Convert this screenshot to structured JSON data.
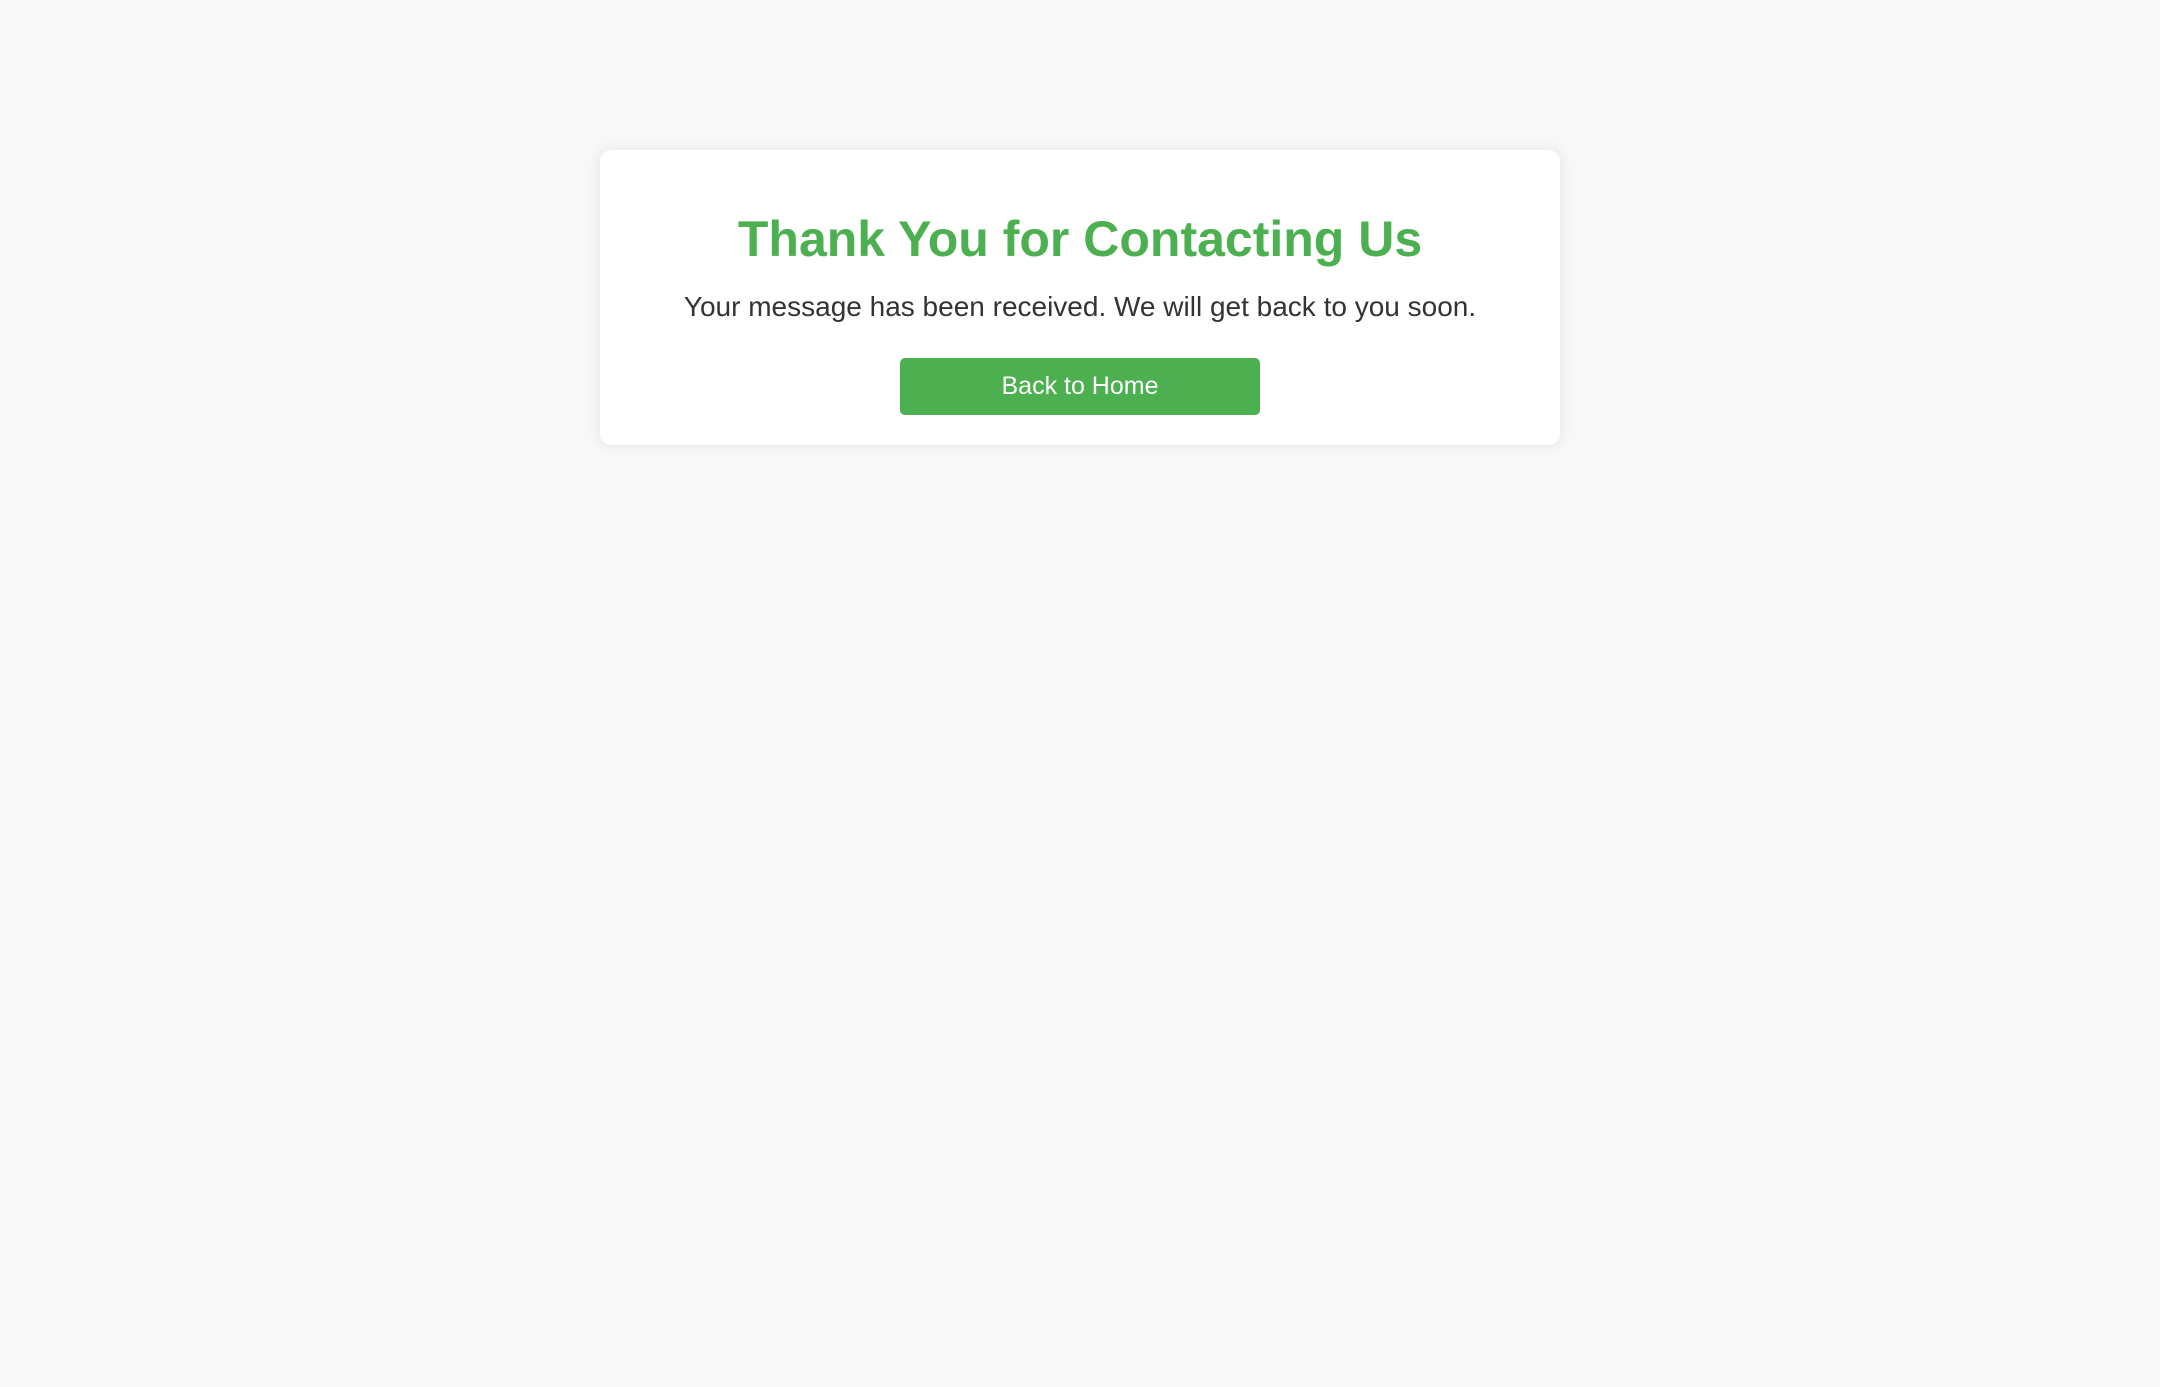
{
  "confirmation": {
    "title": "Thank You for Contacting Us",
    "message": "Your message has been received. We will get back to you soon.",
    "button_label": "Back to Home"
  },
  "colors": {
    "accent": "#4caf50",
    "background": "#f8f8f8",
    "card": "#ffffff",
    "text": "#333333"
  }
}
